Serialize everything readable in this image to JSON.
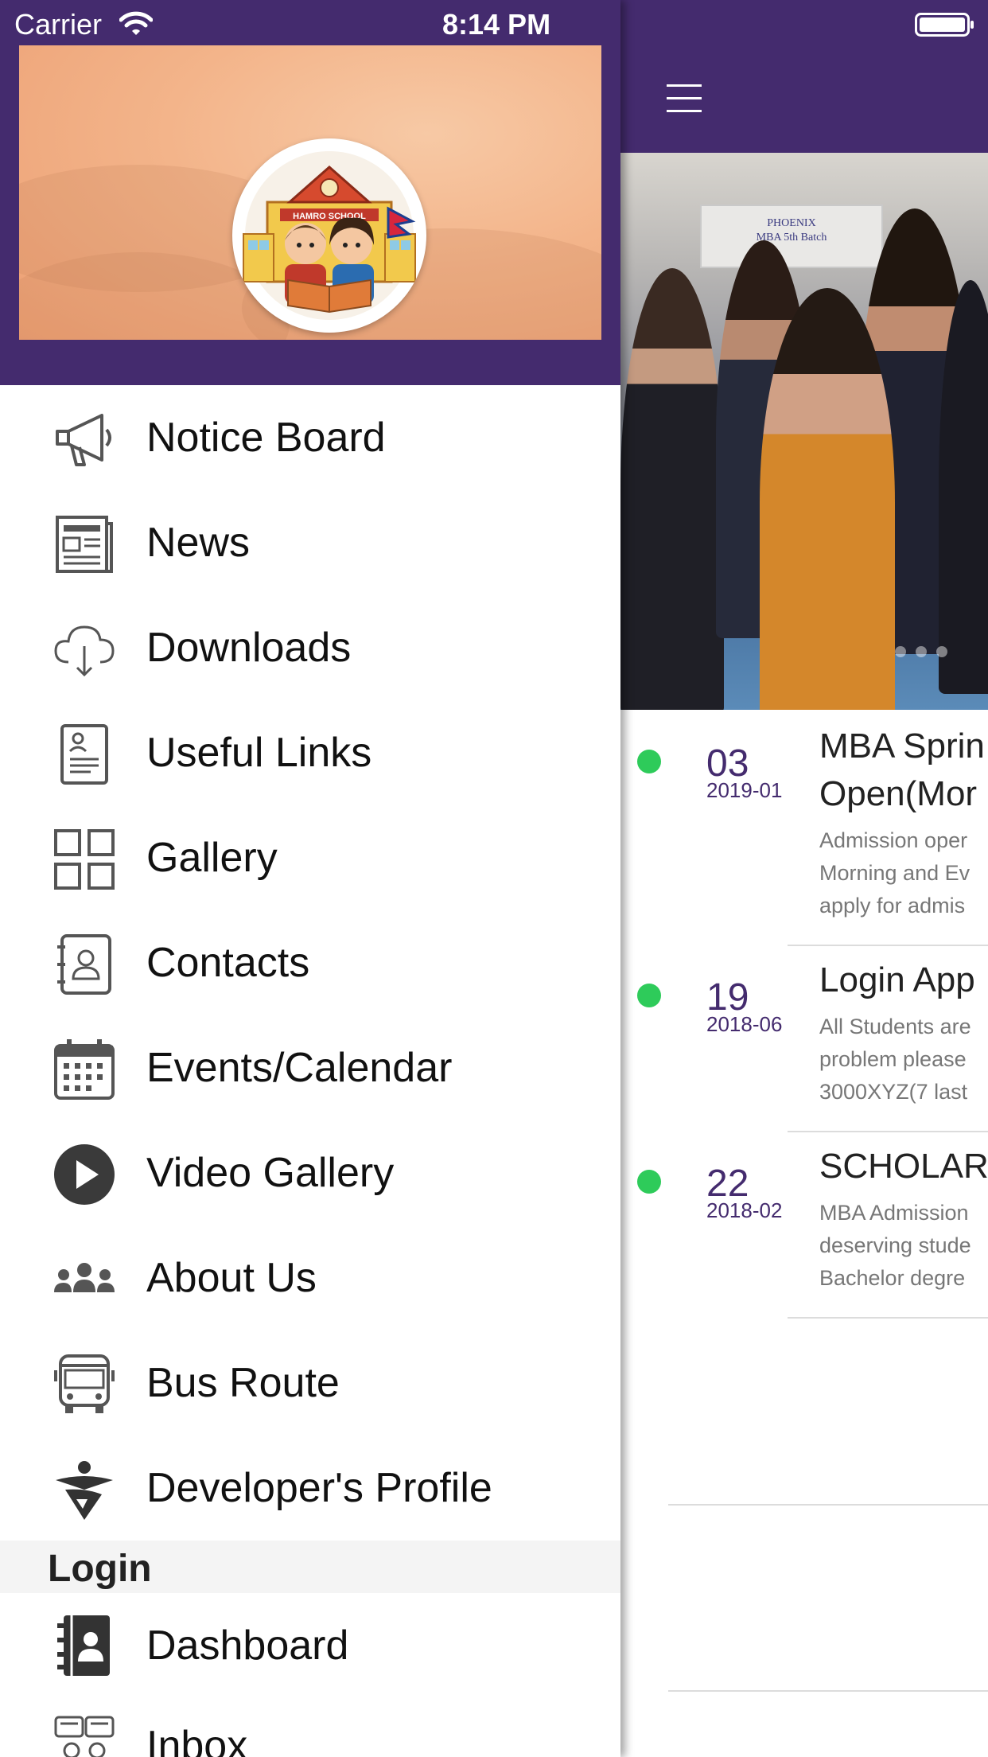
{
  "status_bar": {
    "carrier": "Carrier",
    "time": "8:14 PM",
    "wifi_icon": "wifi-icon",
    "battery_icon": "battery-icon"
  },
  "drawer": {
    "logo_text": "HAMRO SCHOOL",
    "menu_items": [
      {
        "label": "Notice Board",
        "icon": "megaphone-icon"
      },
      {
        "label": "News",
        "icon": "newspaper-icon"
      },
      {
        "label": "Downloads",
        "icon": "cloud-download-icon"
      },
      {
        "label": "Useful Links",
        "icon": "document-user-icon"
      },
      {
        "label": "Gallery",
        "icon": "grid-icon"
      },
      {
        "label": "Contacts",
        "icon": "contact-book-icon"
      },
      {
        "label": "Events/Calendar",
        "icon": "calendar-icon"
      },
      {
        "label": "Video Gallery",
        "icon": "play-circle-icon"
      },
      {
        "label": "About Us",
        "icon": "group-icon"
      },
      {
        "label": "Bus Route",
        "icon": "bus-icon"
      },
      {
        "label": "Developer's Profile",
        "icon": "developer-logo-icon"
      }
    ],
    "login_section": {
      "title": "Login",
      "items": [
        {
          "label": "Dashboard",
          "icon": "dashboard-icon"
        },
        {
          "label": "Inbox",
          "icon": "inbox-chat-icon"
        }
      ]
    }
  },
  "main": {
    "menu_icon": "hamburger-menu-icon",
    "hero": {
      "banner_line1": "PHOENIX",
      "banner_line2": "MBA 5th Batch"
    },
    "events": [
      {
        "day": "03",
        "year_month": "2019-01",
        "title_line1": "MBA Sprin",
        "title_line2": "Open(Mor",
        "desc_lines": [
          "Admission oper",
          "Morning and Ev",
          "apply for admis"
        ]
      },
      {
        "day": "19",
        "year_month": "2018-06",
        "title_line1": "Login App",
        "title_line2": "",
        "desc_lines": [
          "All Students are",
          "problem please",
          "3000XYZ(7 last"
        ]
      },
      {
        "day": "22",
        "year_month": "2018-02",
        "title_line1": "SCHOLARS",
        "title_line2": "",
        "desc_lines": [
          "MBA Admission",
          "deserving stude",
          "Bachelor degre"
        ]
      }
    ]
  },
  "colors": {
    "primary": "#442b6e",
    "status_dot": "#2ecb5a",
    "banner_orange": "#f3b48a"
  }
}
